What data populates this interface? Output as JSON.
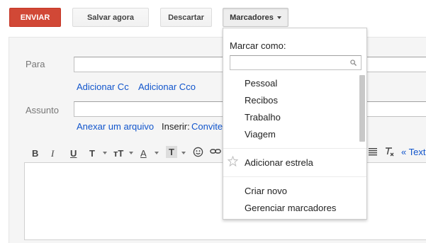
{
  "toolbar": {
    "send_label": "ENVIAR",
    "save_label": "Salvar agora",
    "discard_label": "Descartar",
    "labels_label": "Marcadores"
  },
  "compose": {
    "to_label": "Para",
    "add_cc": "Adicionar Cc",
    "add_bcc": "Adicionar Cco",
    "subject_label": "Assunto",
    "attach_file": "Anexar um arquivo",
    "insert_label": "Inserir:",
    "invite_link": "Convite",
    "more_formatting": "« Text"
  },
  "format_toolbar": {
    "bold": "B",
    "italic": "I",
    "underline": "U",
    "font": "T",
    "size": "тT",
    "text_color": "A",
    "highlight": "T"
  },
  "labels_menu": {
    "title": "Marcar como:",
    "search_placeholder": "",
    "labels": [
      "Pessoal",
      "Recibos",
      "Trabalho",
      "Viagem"
    ],
    "add_star": "Adicionar estrela",
    "create_new": "Criar novo",
    "manage": "Gerenciar marcadores"
  },
  "colors": {
    "send_button": "#d14836",
    "link": "#1155cc"
  }
}
